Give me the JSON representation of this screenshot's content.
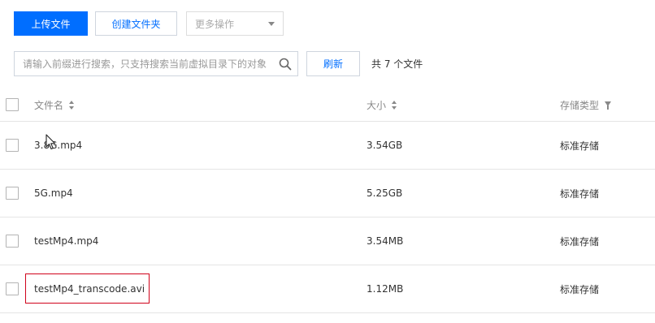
{
  "toolbar": {
    "upload_label": "上传文件",
    "create_folder_label": "创建文件夹",
    "more_actions_label": "更多操作"
  },
  "search": {
    "placeholder": "请输入前缀进行搜索，只支持搜索当前虚拟目录下的对象",
    "refresh_label": "刷新",
    "total_text": "共 7 个文件"
  },
  "table": {
    "headers": {
      "name": "文件名",
      "size": "大小",
      "storage_class": "存储类型"
    },
    "rows": [
      {
        "name": "3.8G.mp4",
        "size": "3.54GB",
        "storage_class": "标准存储"
      },
      {
        "name": "5G.mp4",
        "size": "5.25GB",
        "storage_class": "标准存储"
      },
      {
        "name": "testMp4.mp4",
        "size": "3.54MB",
        "storage_class": "标准存储"
      },
      {
        "name": "testMp4_transcode.avi",
        "size": "1.12MB",
        "storage_class": "标准存储"
      }
    ]
  },
  "colors": {
    "primary": "#006eff",
    "highlight_border": "#d0021b"
  },
  "icons": {
    "search": "search-icon",
    "sort": "sort-icon",
    "filter": "filter-icon",
    "select_caret": "chevron-down-icon",
    "cursor": "mouse-cursor-icon"
  }
}
